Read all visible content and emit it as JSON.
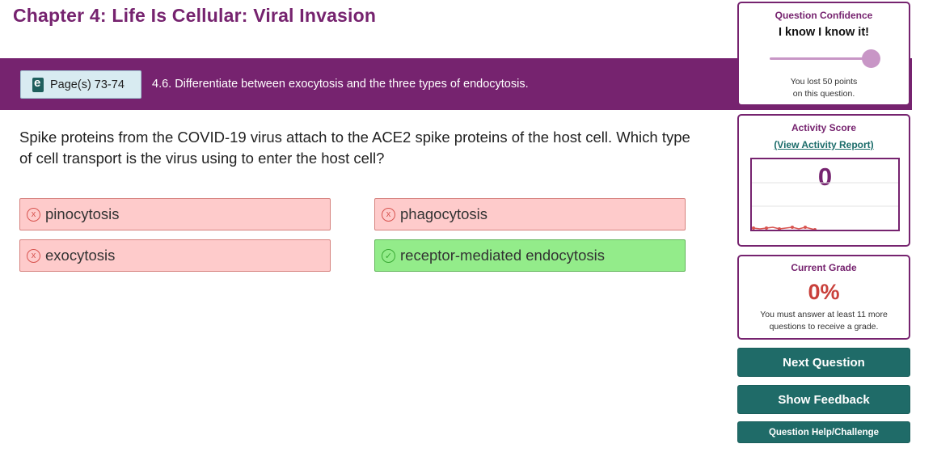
{
  "chapter_title": "Chapter 4: Life Is Cellular: Viral Invasion",
  "page_button_label": "Page(s) 73-74",
  "objective": "4.6. Differentiate between exocytosis and the three types of endocytosis.",
  "question": "Spike proteins from the COVID-19 virus attach to the ACE2 spike proteins of the host cell. Which type of cell transport is the virus using to enter the host cell?",
  "answers": [
    {
      "label": "pinocytosis",
      "mark": "x"
    },
    {
      "label": "phagocytosis",
      "mark": "x"
    },
    {
      "label": "exocytosis",
      "mark": "x"
    },
    {
      "label": "receptor-mediated endocytosis",
      "mark": "✓"
    }
  ],
  "confidence": {
    "title": "Question Confidence",
    "value": "I know I know it!",
    "slider_level": 1.0,
    "note_line1": "You lost 50 points",
    "note_line2": "on this question."
  },
  "activity": {
    "title": "Activity Score",
    "link": "(View Activity Report)",
    "score": "0"
  },
  "grade": {
    "title": "Current Grade",
    "value": "0%",
    "note_line1": "You must answer at least 11 more",
    "note_line2": "questions to receive a grade."
  },
  "buttons": {
    "next": "Next Question",
    "feedback": "Show Feedback",
    "help": "Question Help/Challenge"
  },
  "colors": {
    "brand_purple": "#76236f",
    "teal_button": "#1f6b68",
    "wrong_bg": "#fecbcb",
    "right_bg": "#93ec8a",
    "grade_red": "#c9403b"
  }
}
